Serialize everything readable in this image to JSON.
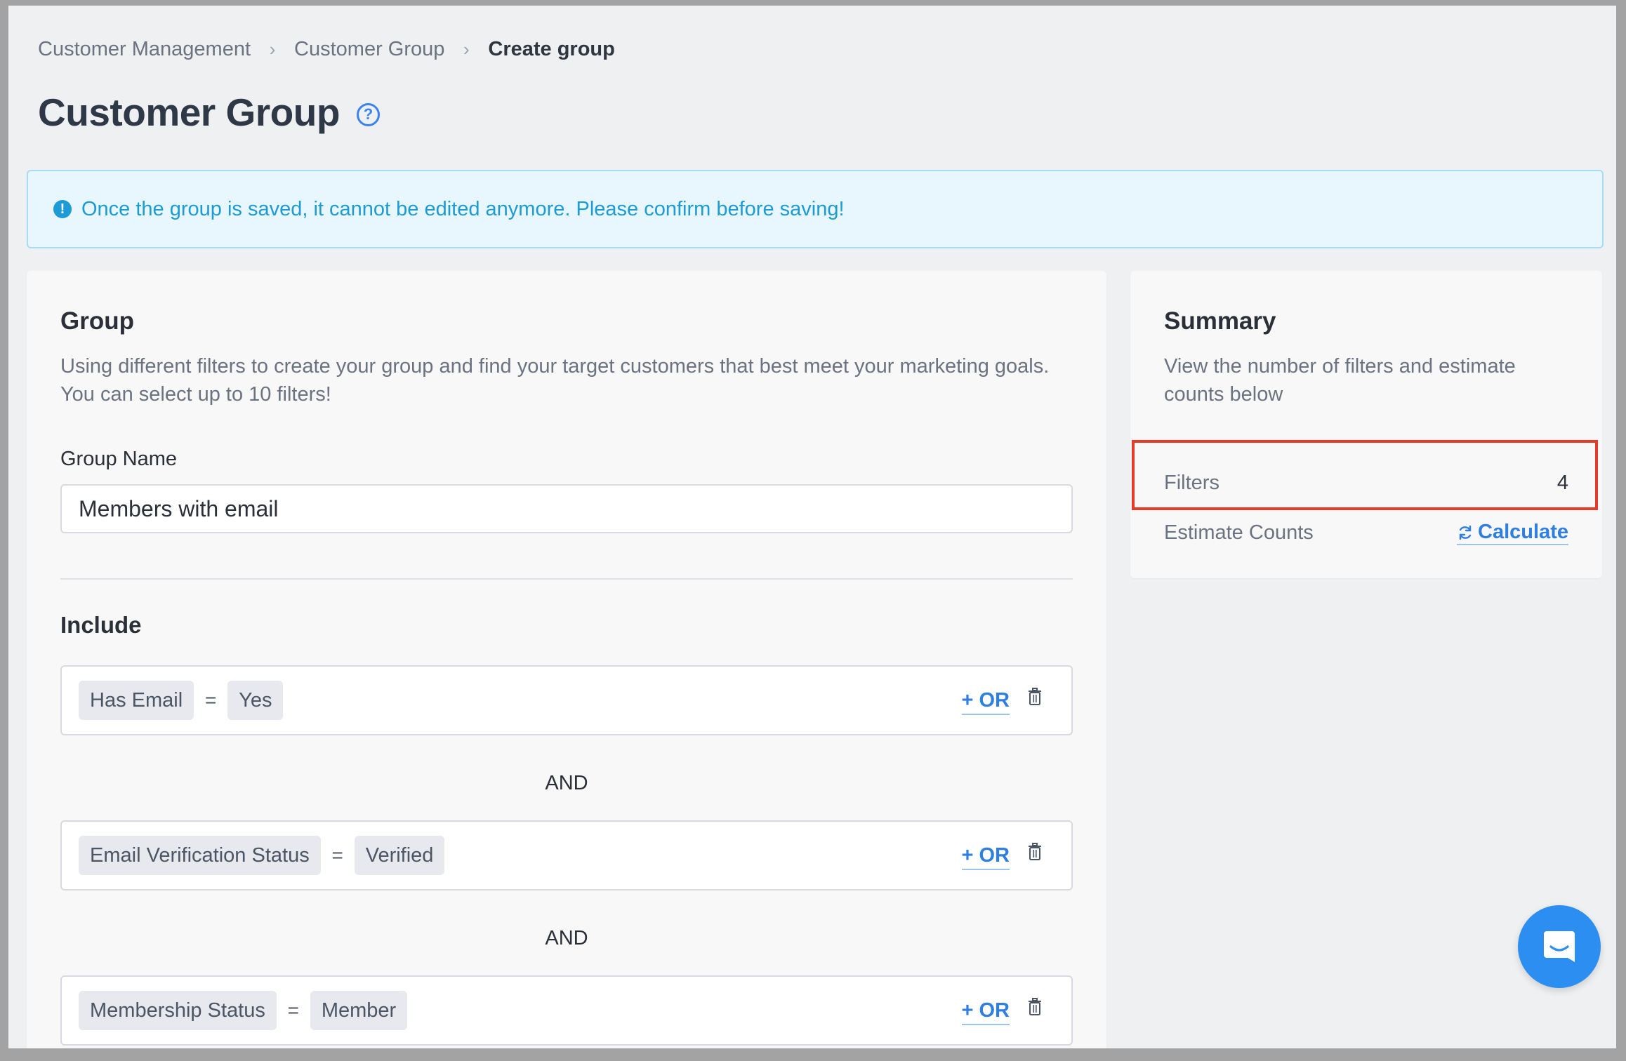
{
  "breadcrumb": {
    "items": [
      "Customer Management",
      "Customer Group"
    ],
    "current": "Create group"
  },
  "page": {
    "title": "Customer Group"
  },
  "alert": {
    "text": "Once the group is saved, it cannot be edited anymore. Please confirm before saving!"
  },
  "group_card": {
    "title": "Group",
    "description": "Using different filters to create your group and find your target customers that best meet your marketing goals. You can select up to 10 filters!",
    "name_label": "Group Name",
    "name_value": "Members with email",
    "include_title": "Include",
    "connector": "AND",
    "or_label": "+ OR",
    "filters": [
      {
        "field": "Has Email",
        "op": "=",
        "value": "Yes"
      },
      {
        "field": "Email Verification Status",
        "op": "=",
        "value": "Verified"
      },
      {
        "field": "Membership Status",
        "op": "=",
        "value": "Member"
      }
    ]
  },
  "summary": {
    "title": "Summary",
    "description": "View the number of filters and estimate counts below",
    "filters_label": "Filters",
    "filters_value": "4",
    "estimate_label": "Estimate Counts",
    "calculate_label": "Calculate"
  },
  "colors": {
    "accent": "#2f7fe0",
    "alert": "#1c9bd6",
    "highlight": "#e4392b",
    "chat": "#2b8ef0"
  },
  "icons": [
    "help-icon",
    "info-icon",
    "trash-icon",
    "refresh-icon",
    "chat-icon",
    "chevron-right-icon"
  ]
}
